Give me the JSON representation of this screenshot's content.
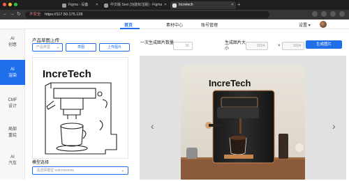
{
  "browser": {
    "tabs": [
      {
        "title": "Figma - 设备"
      },
      {
        "title": "中文版 Sexi (功能标注版) - Figma"
      },
      {
        "title": "Incretech"
      }
    ],
    "address": {
      "security_label": "不安全",
      "url": "https://117.50.175.128"
    }
  },
  "header": {
    "nav": [
      {
        "label": "首页"
      },
      {
        "label": "素材中心"
      },
      {
        "label": "账号管理"
      }
    ],
    "settings_label": "设置",
    "settings_chevron": "▾"
  },
  "sidebar": {
    "items": [
      {
        "line1": "AI",
        "line2": "创意"
      },
      {
        "line1": "AI",
        "line2": "渲染"
      },
      {
        "line1": "CMF",
        "line2": "设计"
      },
      {
        "line1": "局部",
        "line2": "重绘"
      },
      {
        "line1": "AI",
        "line2": "汽车"
      }
    ]
  },
  "upload_panel": {
    "title": "产品草图上传",
    "category_select": {
      "placeholder": "产品类型"
    },
    "buttons": {
      "sketch": "草图",
      "upload": "上传图片"
    },
    "model_label": "模型选择",
    "model_select": {
      "placeholder": "请选择模型 submissions"
    }
  },
  "controls": {
    "count_label": "一次生成图片数量",
    "count_value": "16",
    "size_label": "生成图片大小",
    "width_value": "1024",
    "height_value": "1024",
    "times_sign": "×",
    "generate_label": "生成图片"
  },
  "viewer": {
    "prev": "‹",
    "next": "›"
  },
  "sketch": {
    "brand_text": "IncreTech"
  },
  "result_image": {
    "brand_text": "IncreTech"
  },
  "colors": {
    "accent": "#1f6feb",
    "chrome_dark": "#1f1f1f",
    "viewer_bg": "#e1e1e1"
  }
}
